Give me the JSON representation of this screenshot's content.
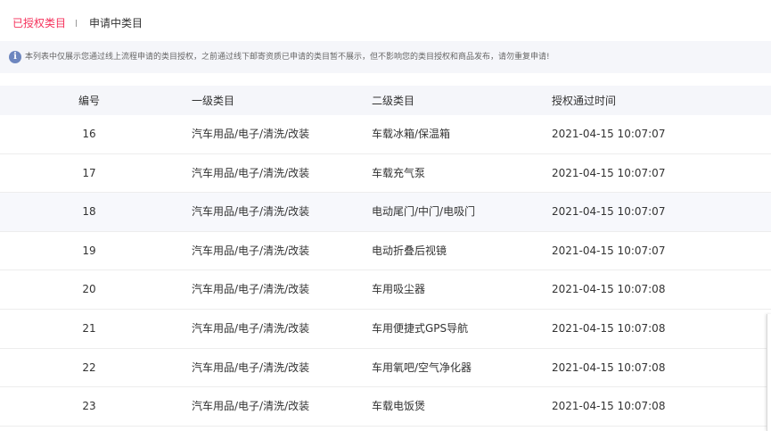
{
  "tabs": {
    "authorized": "已授权类目",
    "applying": "申请中类目"
  },
  "notice": {
    "icon": "info-icon",
    "text": "本列表中仅展示您通过线上流程申请的类目授权，之前通过线下邮寄资质已申请的类目暂不展示，但不影响您的类目授权和商品发布，请勿重复申请!"
  },
  "table": {
    "headers": {
      "id": "编号",
      "level1": "一级类目",
      "level2": "二级类目",
      "time": "授权通过时间"
    },
    "rows": [
      {
        "id": "16",
        "level1": "汽车用品/电子/清洗/改装",
        "level2": "车载冰箱/保温箱",
        "time": "2021-04-15 10:07:07"
      },
      {
        "id": "17",
        "level1": "汽车用品/电子/清洗/改装",
        "level2": "车载充气泵",
        "time": "2021-04-15 10:07:07"
      },
      {
        "id": "18",
        "level1": "汽车用品/电子/清洗/改装",
        "level2": "电动尾门/中门/电吸门",
        "time": "2021-04-15 10:07:07"
      },
      {
        "id": "19",
        "level1": "汽车用品/电子/清洗/改装",
        "level2": "电动折叠后视镜",
        "time": "2021-04-15 10:07:07"
      },
      {
        "id": "20",
        "level1": "汽车用品/电子/清洗/改装",
        "level2": "车用吸尘器",
        "time": "2021-04-15 10:07:08"
      },
      {
        "id": "21",
        "level1": "汽车用品/电子/清洗/改装",
        "level2": "车用便捷式GPS导航",
        "time": "2021-04-15 10:07:08"
      },
      {
        "id": "22",
        "level1": "汽车用品/电子/清洗/改装",
        "level2": "车用氧吧/空气净化器",
        "time": "2021-04-15 10:07:08"
      },
      {
        "id": "23",
        "level1": "汽车用品/电子/清洗/改装",
        "level2": "车载电饭煲",
        "time": "2021-04-15 10:07:08"
      }
    ]
  },
  "colors": {
    "active_tab": "#f5315b",
    "notice_bg": "#f5f6fa",
    "info_icon": "#6d86bf",
    "highlight_row": "#f7f8fc"
  }
}
